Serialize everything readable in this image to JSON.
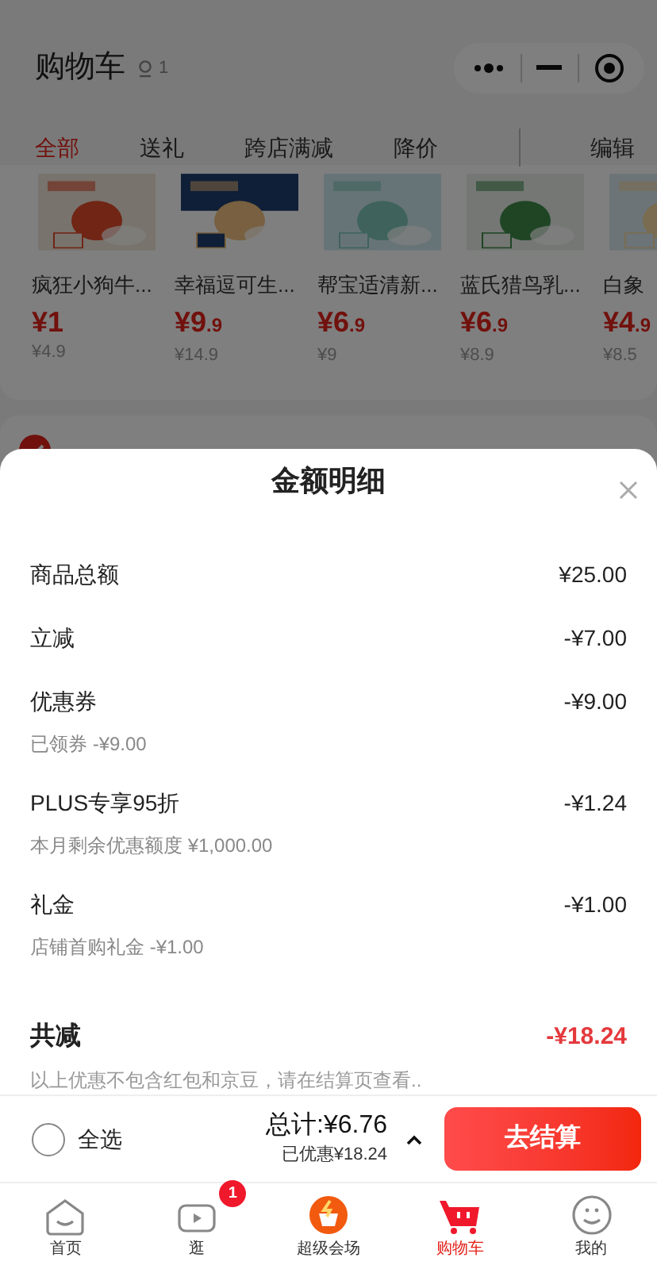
{
  "header": {
    "title": "购物车",
    "location_count": "1"
  },
  "filter_tabs": [
    {
      "label": "全部",
      "selected": true
    },
    {
      "label": "送礼",
      "selected": false
    },
    {
      "label": "跨店满减",
      "selected": false
    },
    {
      "label": "降价",
      "selected": false
    }
  ],
  "edit": "编辑",
  "products": [
    {
      "name": "疯狂小狗牛...",
      "price": "¥1",
      "original": "¥4.9"
    },
    {
      "name": "幸福逗可生...",
      "price": "¥9.9",
      "original": "¥14.9"
    },
    {
      "name": "帮宝适清新...",
      "price": "¥6.9",
      "original": "¥9"
    },
    {
      "name": "蓝氏猎鸟乳...",
      "price": "¥6.9",
      "original": "¥8.9"
    },
    {
      "name": "白象",
      "price": "¥4.9",
      "original": "¥8.5"
    }
  ],
  "sheet": {
    "title": "金额明细",
    "rows": [
      {
        "label": "商品总额",
        "amount": "¥25.00"
      },
      {
        "label": "立减",
        "amount": "-¥7.00"
      },
      {
        "label": "优惠券",
        "amount": "-¥9.00",
        "note": "已领券 -¥9.00"
      },
      {
        "label": "PLUS专享95折",
        "amount": "-¥1.24",
        "note": "本月剩余优惠额度 ¥1,000.00"
      },
      {
        "label": "礼金",
        "amount": "-¥1.00",
        "note": "店铺首购礼金 -¥1.00"
      }
    ],
    "total": {
      "label": "共减",
      "amount": "-¥18.24",
      "note": "以上优惠不包含红包和京豆，请在结算页查看.."
    }
  },
  "checkout": {
    "select_all": "全选",
    "select_all_checked": false,
    "total": "总计:¥6.76",
    "saved": "已优惠¥18.24",
    "button": "去结算"
  },
  "tab_bar": [
    {
      "label": "首页",
      "selected": false
    },
    {
      "label": "逛",
      "selected": false,
      "badge": "1"
    },
    {
      "label": "超级会场",
      "selected": false
    },
    {
      "label": "购物车",
      "selected": true
    },
    {
      "label": "我的",
      "selected": false
    }
  ]
}
